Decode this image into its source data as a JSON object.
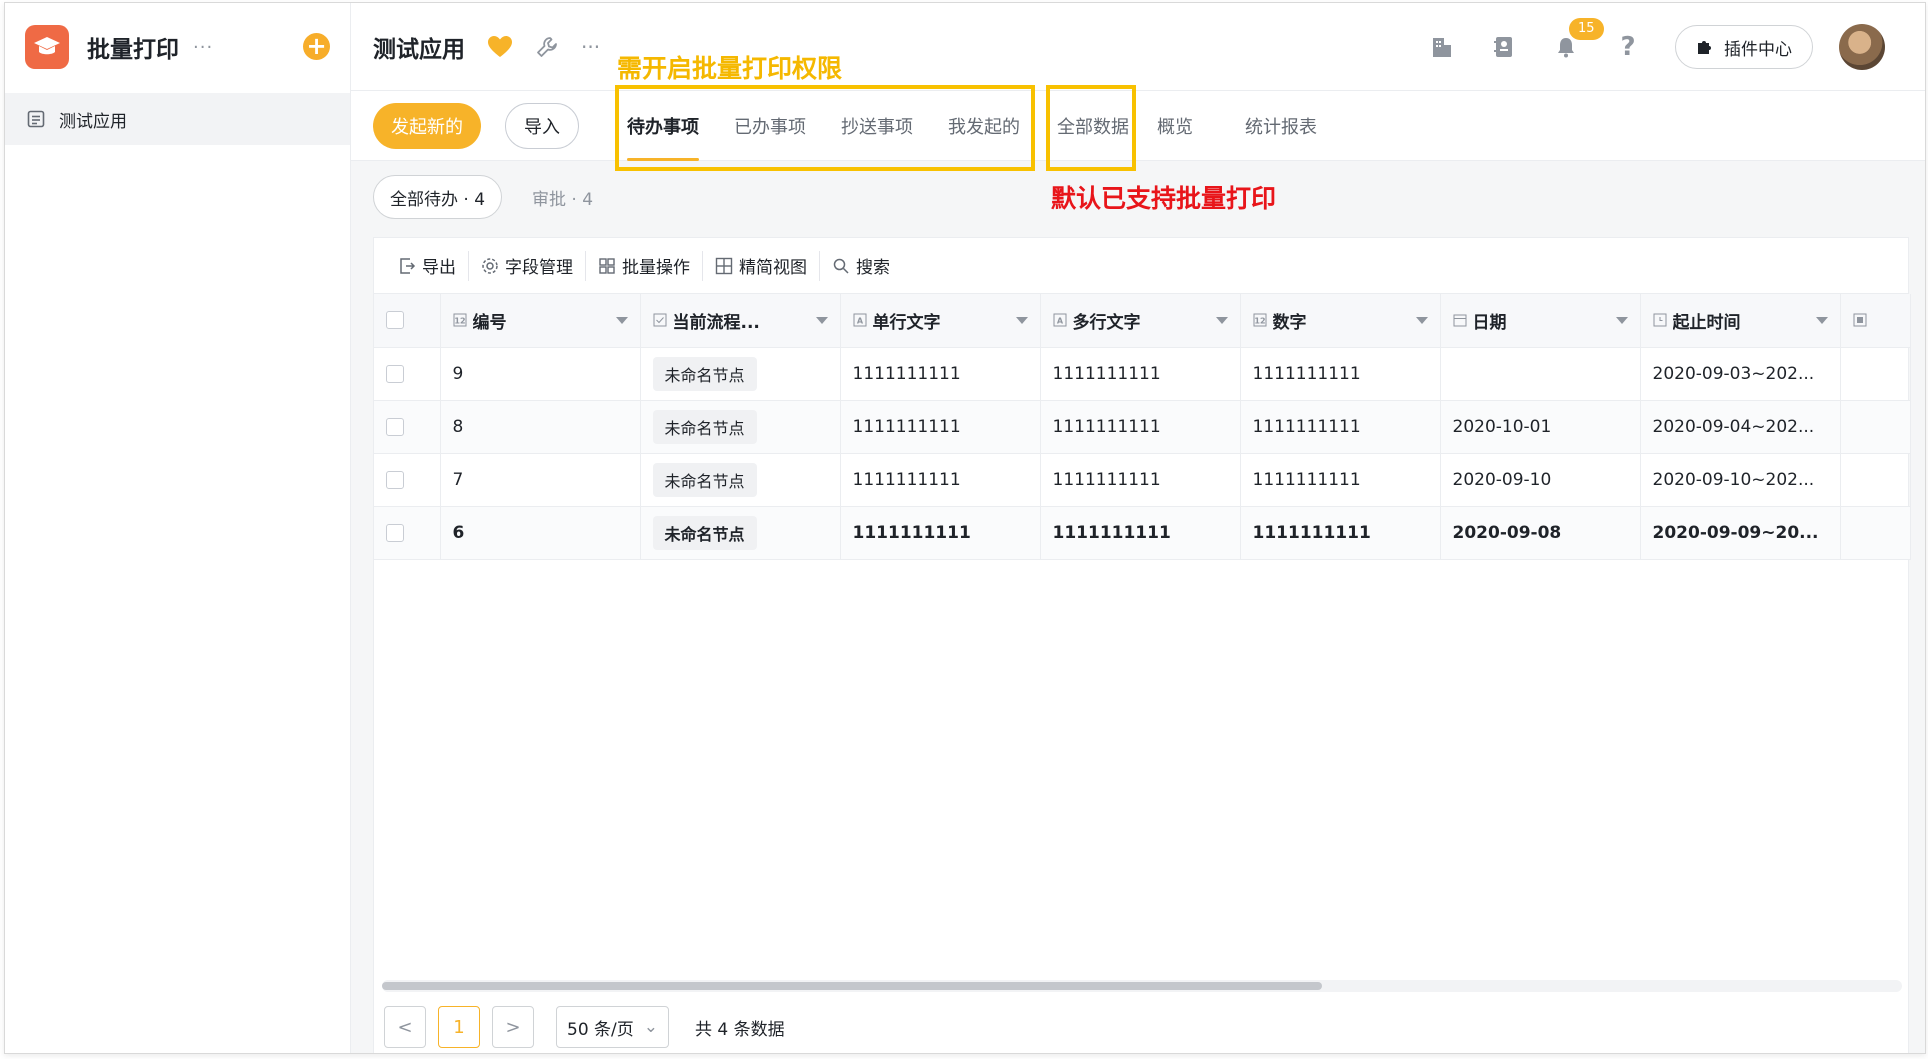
{
  "sidebar": {
    "app_title": "批量打印",
    "more_label": "···",
    "items": [
      {
        "label": "测试应用"
      }
    ]
  },
  "header": {
    "app_name": "测试应用",
    "more_label": "···",
    "notification_count": "15",
    "plugin_label": "插件中心"
  },
  "toolbar": {
    "create_label": "发起新的",
    "import_label": "导入",
    "tabs": [
      {
        "label": "待办事项"
      },
      {
        "label": "已办事项"
      },
      {
        "label": "抄送事项"
      },
      {
        "label": "我发起的"
      },
      {
        "label": "全部数据"
      },
      {
        "label": "概览"
      },
      {
        "label": "统计报表"
      }
    ]
  },
  "annotations": {
    "batch_permission": "需开启批量打印权限",
    "default_supported": "默认已支持批量打印"
  },
  "filters": {
    "all_pending": "全部待办 · 4",
    "approval": "审批 · 4"
  },
  "table_toolbar": {
    "export": "导出",
    "fields": "字段管理",
    "batch": "批量操作",
    "compact_view": "精简视图",
    "search": "搜索"
  },
  "columns": [
    "编号",
    "当前流程...",
    "单行文字",
    "多行文字",
    "数字",
    "日期",
    "起止时间"
  ],
  "rows": [
    {
      "id": "9",
      "node": "未命名节点",
      "single": "1111111111",
      "multi": "1111111111",
      "number": "1111111111",
      "date": "",
      "range": "2020-09-03~202..."
    },
    {
      "id": "8",
      "node": "未命名节点",
      "single": "1111111111",
      "multi": "1111111111",
      "number": "1111111111",
      "date": "2020-10-01",
      "range": "2020-09-04~202..."
    },
    {
      "id": "7",
      "node": "未命名节点",
      "single": "1111111111",
      "multi": "1111111111",
      "number": "1111111111",
      "date": "2020-09-10",
      "range": "2020-09-10~202..."
    },
    {
      "id": "6",
      "node": "未命名节点",
      "single": "1111111111",
      "multi": "1111111111",
      "number": "1111111111",
      "date": "2020-09-08",
      "range": "2020-09-09~20..."
    }
  ],
  "pager": {
    "prev": "<",
    "current": "1",
    "next": ">",
    "page_size": "50 条/页",
    "total": "共 4 条数据"
  },
  "colors": {
    "accent": "#f7b329",
    "annotation_yellow": "#f5b800",
    "annotation_red": "#e8151a"
  }
}
